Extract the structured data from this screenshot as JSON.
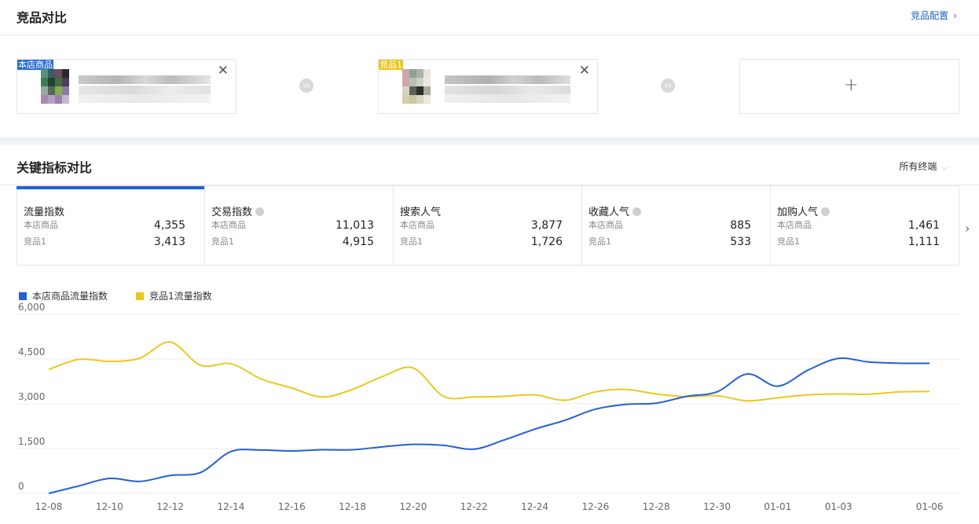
{
  "header": {
    "title": "竞品对比",
    "config_label": "竞品配置",
    "config_chevron": "›"
  },
  "products": [
    {
      "tag": "本店商品",
      "tag_color": "#2b6ed6"
    },
    {
      "tag": "竞品1",
      "tag_color": "#e9c61c"
    }
  ],
  "close_glyph": "✕",
  "vs_label": "vs",
  "add_glyph": "+",
  "section": {
    "title": "关键指标对比",
    "terminal_label": "所有终端",
    "caret": "⌵"
  },
  "metrics": [
    {
      "name": "流量指数",
      "info": false,
      "mine_label": "本店商品",
      "mine_value": "4,355",
      "comp_label": "竞品1",
      "comp_value": "3,413"
    },
    {
      "name": "交易指数",
      "info": true,
      "mine_label": "本店商品",
      "mine_value": "11,013",
      "comp_label": "竞品1",
      "comp_value": "4,915"
    },
    {
      "name": "搜索人气",
      "info": false,
      "mine_label": "本店商品",
      "mine_value": "3,877",
      "comp_label": "竞品1",
      "comp_value": "1,726"
    },
    {
      "name": "收藏人气",
      "info": true,
      "mine_label": "本店商品",
      "mine_value": "885",
      "comp_label": "竞品1",
      "comp_value": "533"
    },
    {
      "name": "加购人气",
      "info": true,
      "mine_label": "本店商品",
      "mine_value": "1,461",
      "comp_label": "竞品1",
      "comp_value": "1,111"
    }
  ],
  "next_arrow": "›",
  "chart_data": {
    "type": "line",
    "x": [
      "12-08",
      "12-09",
      "12-10",
      "12-11",
      "12-12",
      "12-13",
      "12-14",
      "12-15",
      "12-16",
      "12-17",
      "12-18",
      "12-19",
      "12-20",
      "12-21",
      "12-22",
      "12-23",
      "12-24",
      "12-25",
      "12-26",
      "12-27",
      "12-28",
      "12-29",
      "12-30",
      "12-31",
      "01-01",
      "01-02",
      "01-03",
      "01-04",
      "01-05",
      "01-06"
    ],
    "x_tick_labels": [
      "12-08",
      "12-10",
      "12-12",
      "12-14",
      "12-16",
      "12-18",
      "12-20",
      "12-22",
      "12-24",
      "12-26",
      "12-28",
      "12-30",
      "01-01",
      "01-03",
      "01-06"
    ],
    "y_ticks": [
      "0",
      "1,500",
      "3,000",
      "4,500",
      "6,000"
    ],
    "ylim": [
      0,
      6000
    ],
    "grid": true,
    "legend_position": "top-left",
    "series": [
      {
        "name": "本店商品流量指数",
        "color": "#2361d4",
        "values": [
          0,
          250,
          500,
          400,
          600,
          700,
          1400,
          1450,
          1420,
          1460,
          1460,
          1560,
          1640,
          1610,
          1480,
          1790,
          2150,
          2450,
          2820,
          2980,
          3020,
          3250,
          3400,
          4000,
          3590,
          4130,
          4520,
          4400,
          4360,
          4355
        ]
      },
      {
        "name": "竞品1流量指数",
        "color": "#ecc81e",
        "values": [
          4150,
          4490,
          4420,
          4530,
          5070,
          4290,
          4340,
          3830,
          3530,
          3230,
          3480,
          3920,
          4200,
          3250,
          3230,
          3250,
          3300,
          3120,
          3400,
          3480,
          3330,
          3240,
          3270,
          3100,
          3200,
          3300,
          3330,
          3320,
          3400,
          3413
        ]
      }
    ]
  }
}
